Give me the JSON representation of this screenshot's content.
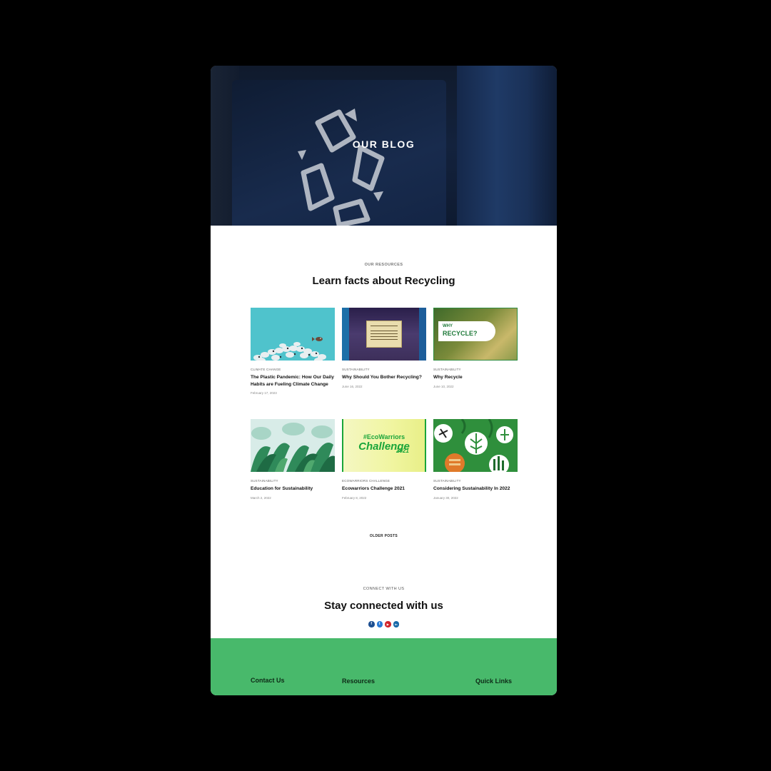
{
  "hero": {
    "title": "OUR BLOG"
  },
  "resources": {
    "eyebrow": "OUR RESOURCES",
    "title": "Learn facts about Recycling"
  },
  "posts": [
    {
      "category": "CLIMATE CHANGE",
      "title": "The Plastic Pandemic: How Our Daily Habits are Fueling Climate Change",
      "date": "February 17, 2023"
    },
    {
      "category": "SUSTAINABILITY",
      "title": "Why Should You Bother Recycling?",
      "date": "June 16, 2022"
    },
    {
      "category": "SUSTAINABILITY",
      "title": "Why Recycle",
      "date": "June 10, 2022",
      "thumb_text_1": "WHY",
      "thumb_text_2": "RECYCLE?"
    },
    {
      "category": "SUSTAINABILITY",
      "title": "Education for Sustainability",
      "date": "March 2, 2022"
    },
    {
      "category": "ECOWARRIORS CHALLENGE",
      "title": "Ecowarriors Challenge 2021",
      "date": "February 8, 2022",
      "thumb_text_1": "#EcoWarriors",
      "thumb_text_2": "Challenge",
      "thumb_text_3": "2021"
    },
    {
      "category": "SUSTAINABILITY",
      "title": "Considering Sustainability In 2022",
      "date": "January 30, 2022"
    }
  ],
  "pagination": {
    "older_label": "OLDER POSTS"
  },
  "connect": {
    "eyebrow": "CONNECT WITH US",
    "title": "Stay connected with us",
    "socials": [
      {
        "icon": "facebook-icon",
        "glyph": "f",
        "color": "#1d4f91"
      },
      {
        "icon": "twitter-icon",
        "glyph": "t",
        "color": "#2a7ad6"
      },
      {
        "icon": "youtube-icon",
        "glyph": "▶",
        "color": "#d2232a"
      },
      {
        "icon": "linkedin-icon",
        "glyph": "in",
        "color": "#1769a8"
      }
    ]
  },
  "footer": {
    "contact_label": "Contact Us",
    "resources_label": "Resources",
    "quick_links_label": "Quick Links"
  },
  "colors": {
    "footer_bg": "#48b96b",
    "page_bg": "#000000"
  }
}
